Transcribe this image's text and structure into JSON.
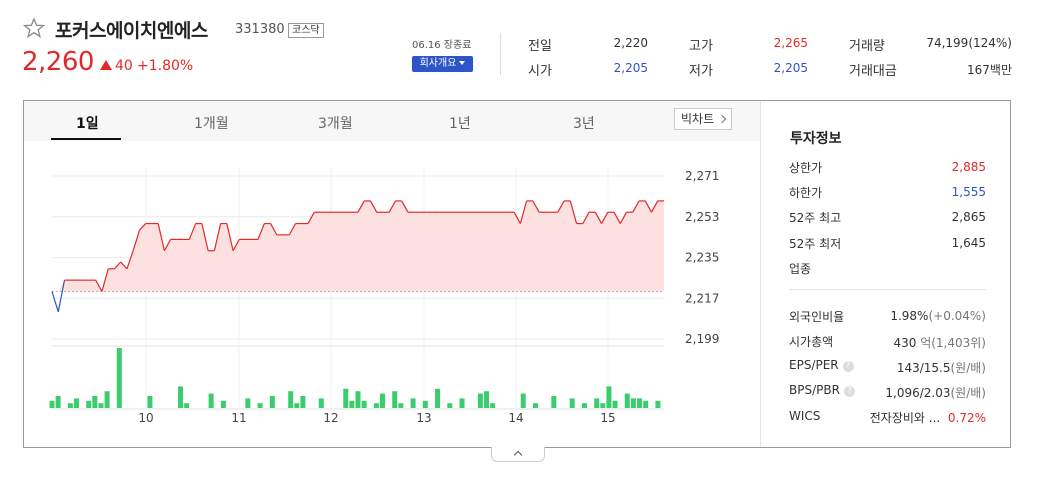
{
  "header": {
    "stock_name": "포커스에이치엔에스",
    "stock_code": "331380",
    "market": "코스닥",
    "price": "2,260",
    "change": "40",
    "change_rate": "+1.80%",
    "status_date": "06.16 장종료",
    "company_button": "회사개요",
    "stats": {
      "prev_close": {
        "label": "전일",
        "value": "2,220"
      },
      "open": {
        "label": "시가",
        "value": "2,205"
      },
      "high": {
        "label": "고가",
        "value": "2,265"
      },
      "low": {
        "label": "저가",
        "value": "2,205"
      },
      "volume": {
        "label": "거래량",
        "value": "74,199(124%)"
      },
      "trade_value": {
        "label": "거래대금",
        "value": "167백만"
      }
    }
  },
  "tabs": [
    "1일",
    "1개월",
    "3개월",
    "1년",
    "3년"
  ],
  "active_tab": "1일",
  "big_chart_button": "빅차트",
  "chart_data": {
    "type": "line",
    "y_ticks": [
      "2,271",
      "2,253",
      "2,235",
      "2,217",
      "2,199"
    ],
    "x_ticks": [
      "10",
      "11",
      "12",
      "13",
      "14",
      "15"
    ],
    "ylim": [
      2199,
      2271
    ],
    "prev_close": 2220,
    "price_series": [
      2220,
      2211,
      2225,
      2225,
      2225,
      2225,
      2225,
      2225,
      2220,
      2230,
      2230,
      2233,
      2230,
      2238,
      2247,
      2250,
      2250,
      2250,
      2238,
      2243,
      2243,
      2243,
      2243,
      2250,
      2250,
      2238,
      2238,
      2250,
      2250,
      2238,
      2243,
      2243,
      2243,
      2243,
      2250,
      2250,
      2245,
      2245,
      2245,
      2250,
      2250,
      2250,
      2255,
      2255,
      2255,
      2255,
      2255,
      2255,
      2255,
      2255,
      2260,
      2260,
      2255,
      2255,
      2255,
      2260,
      2260,
      2255,
      2255,
      2255,
      2255,
      2255,
      2255,
      2255,
      2255,
      2255,
      2255,
      2255,
      2255,
      2255,
      2255,
      2255,
      2255,
      2255,
      2255,
      2250,
      2260,
      2260,
      2255,
      2255,
      2255,
      2255,
      2260,
      2260,
      2250,
      2250,
      2255,
      2255,
      2250,
      2255,
      2255,
      2250,
      2255,
      2255,
      2260,
      2260,
      2255,
      2260,
      2260
    ],
    "volume_series": [
      3,
      5,
      0,
      2,
      4,
      0,
      3,
      5,
      2,
      7,
      0,
      25,
      0,
      0,
      0,
      0,
      5,
      0,
      0,
      0,
      0,
      9,
      2,
      0,
      0,
      0,
      6,
      0,
      3,
      0,
      0,
      0,
      4,
      0,
      2,
      0,
      5,
      0,
      0,
      7,
      2,
      5,
      0,
      0,
      4,
      0,
      0,
      0,
      8,
      3,
      7,
      3,
      0,
      2,
      6,
      0,
      7,
      2,
      0,
      4,
      0,
      3,
      0,
      8,
      0,
      2,
      0,
      4,
      0,
      0,
      6,
      7,
      2,
      0,
      0,
      0,
      0,
      6,
      0,
      2,
      0,
      0,
      5,
      0,
      0,
      4,
      0,
      2,
      0,
      4,
      2,
      9,
      3,
      0,
      6,
      4,
      4,
      3,
      0,
      3,
      0
    ]
  },
  "investment": {
    "title": "투자정보",
    "rows": [
      {
        "label": "상한가",
        "value": "2,885",
        "color": "red"
      },
      {
        "label": "하한가",
        "value": "1,555",
        "color": "blue"
      },
      {
        "label": "52주 최고",
        "value": "2,865",
        "color": "dark"
      },
      {
        "label": "52주 최저",
        "value": "1,645",
        "color": "dark"
      },
      {
        "label": "업종",
        "value": "",
        "color": "dark"
      }
    ],
    "foreign_ratio": {
      "label": "외국인비율",
      "value": "1.98%",
      "sub": "(+0.04%)"
    },
    "market_cap": {
      "label": "시가총액",
      "value": "430",
      "sub": "억(1,403위)"
    },
    "eps_per": {
      "label": "EPS/PER",
      "value": "143/15.5",
      "sub": "(원/배)"
    },
    "bps_pbr": {
      "label": "BPS/PBR",
      "value": "1,096/2.03",
      "sub": "(원/배)"
    },
    "wics": {
      "label": "WICS",
      "value": "전자장비와 ...",
      "rate": "0.72%"
    }
  },
  "colors": {
    "up": "#e22929",
    "down": "#2d55c7",
    "volume": "#3bcc6e"
  }
}
